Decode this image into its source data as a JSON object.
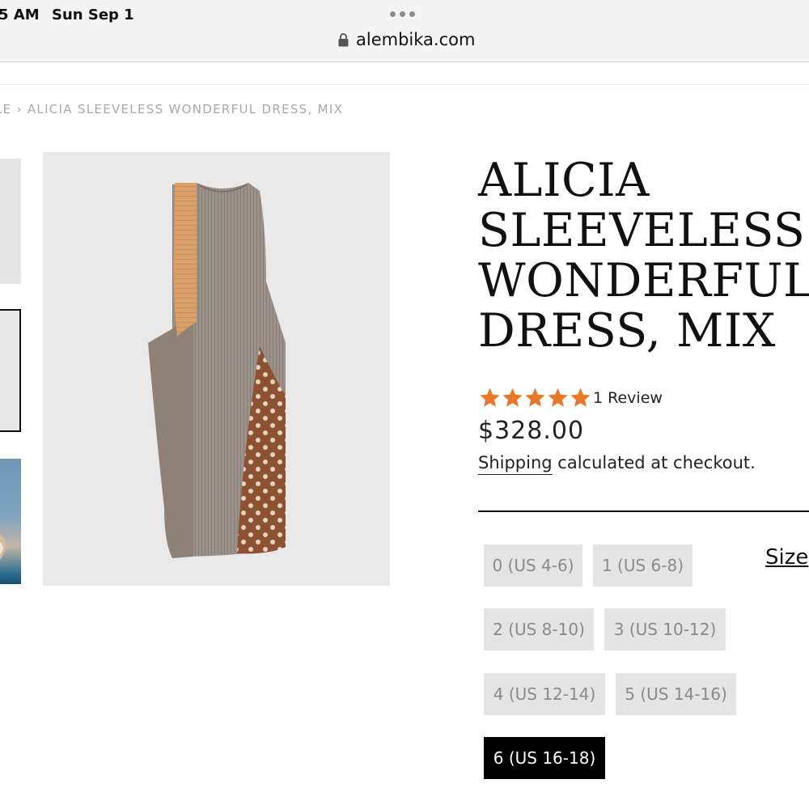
{
  "status_bar": {
    "time": "5 AM",
    "date": "Sun Sep 1"
  },
  "browser": {
    "url": "alembika.com"
  },
  "breadcrumb": "LE › ALICIA SLEEVELESS WONDERFUL DRESS, MIX",
  "product": {
    "title_lines": [
      "ALICIA",
      "SLEEVELESS",
      "WONDERFUL",
      "DRESS, MIX"
    ],
    "rating": 5,
    "review_count": "1 Review",
    "price": "$328.00",
    "shipping_link": "Shipping",
    "shipping_text": " calculated at checkout."
  },
  "sizes": {
    "options": [
      "0 (US 4-6)",
      "1 (US 6-8)",
      "2 (US 8-10)",
      "3 (US 10-12)",
      "4 (US 12-14)",
      "5 (US 14-16)",
      "6 (US 16-18)"
    ],
    "selected": "6 (US 16-18)",
    "chart_link": "Size"
  },
  "colors": {
    "star": "#e8782a",
    "selected_bg": "#000000",
    "option_bg": "#e4e4e4"
  },
  "icons": {
    "lock": "lock-icon",
    "star": "star-icon",
    "more": "more-dots-icon"
  }
}
